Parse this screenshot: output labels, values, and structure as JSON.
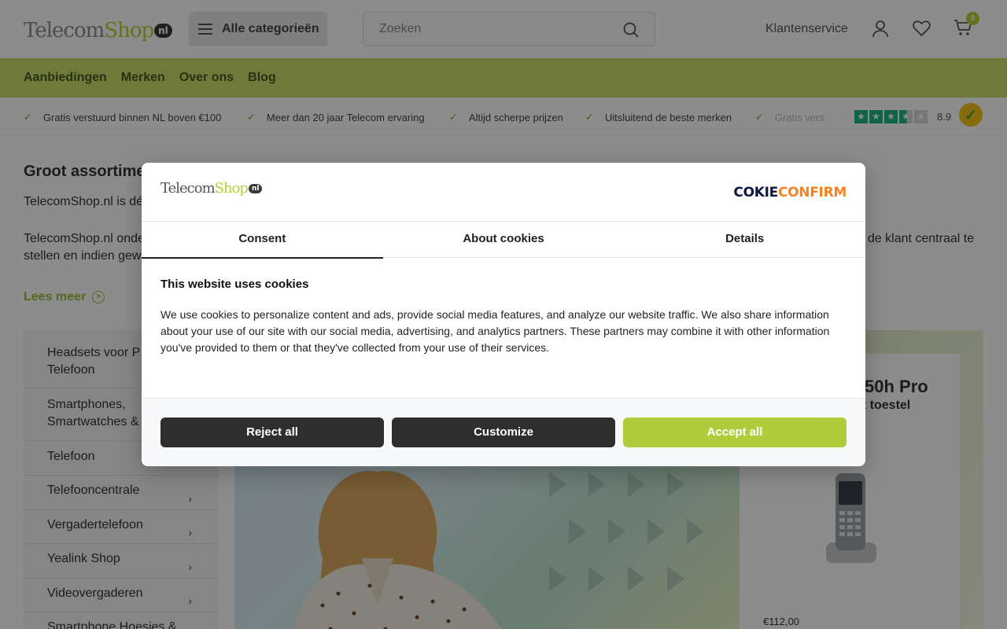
{
  "header": {
    "logo": {
      "part1": "Telecom",
      "part2": "Shop",
      "suffix": "nl"
    },
    "categories_label": "Alle categorieën",
    "search_placeholder": "Zoeken",
    "customer_service": "Klantenservice",
    "cart_count": "0"
  },
  "nav": {
    "items": [
      "Aanbiedingen",
      "Merken",
      "Over ons",
      "Blog"
    ]
  },
  "usp": {
    "items": [
      "Gratis verstuurd binnen NL boven €100",
      "Meer dan 20 jaar Telecom ervaring",
      "Altijd scherpe prijzen",
      "Uitsluitend de beste merken",
      "Gratis vers"
    ],
    "rating_score": "8.9",
    "rating_stars": 4.5
  },
  "content": {
    "title": "Groot assortime",
    "paragraph1": "TelecomShop.nl is dé",
    "paragraph2_line1": "TelecomShop.nl onde",
    "paragraph2_right": "t de klant centraal te",
    "paragraph2_line2": "stellen en indien gew",
    "read_more": "Lees meer"
  },
  "sidebar": {
    "items": [
      {
        "label_line1": "Headsets voor P",
        "label_line2": "Telefoon"
      },
      {
        "label_line1": "Smartphones,",
        "label_line2": "Smartwatches &"
      },
      {
        "label_line1": "Telefoon",
        "label_line2": ""
      },
      {
        "label_line1": "Telefooncentrale",
        "label_line2": ""
      },
      {
        "label_line1": "Vergadertelefoon",
        "label_line2": ""
      },
      {
        "label_line1": "Yealink Shop",
        "label_line2": ""
      },
      {
        "label_line1": "Videovergaderen",
        "label_line2": ""
      },
      {
        "label_line1": "Smartphone Hoesjes &",
        "label_line2": ""
      }
    ]
  },
  "promo": {
    "title": "50h Pro",
    "subtitle": "ct toestel",
    "price": "€112,00"
  },
  "cookie_modal": {
    "logo": {
      "part1": "Telecom",
      "part2": "Shop",
      "suffix": "nl"
    },
    "brand": {
      "part1": "C",
      "part1b": "OKIE",
      "part2": "CONFIRM"
    },
    "tabs": [
      "Consent",
      "About cookies",
      "Details"
    ],
    "heading": "This website uses cookies",
    "body": "We use cookies to personalize content and ads, provide social media features, and analyze our website traffic. We also share information about your use of our site with our social media, advertising, and analytics partners. These partners may combine it with other information you've provided to them or that they've collected from your use of their services.",
    "buttons": {
      "reject": "Reject all",
      "customize": "Customize",
      "accept": "Accept all"
    }
  },
  "colors": {
    "brand_green": "#b5cf3a",
    "nav_green": "#c9dc6b",
    "dark_button": "#2e2e2e",
    "rating_green": "#1bb67e",
    "cookieconfirm_navy": "#0b1640",
    "cookieconfirm_orange": "#f5821f"
  }
}
